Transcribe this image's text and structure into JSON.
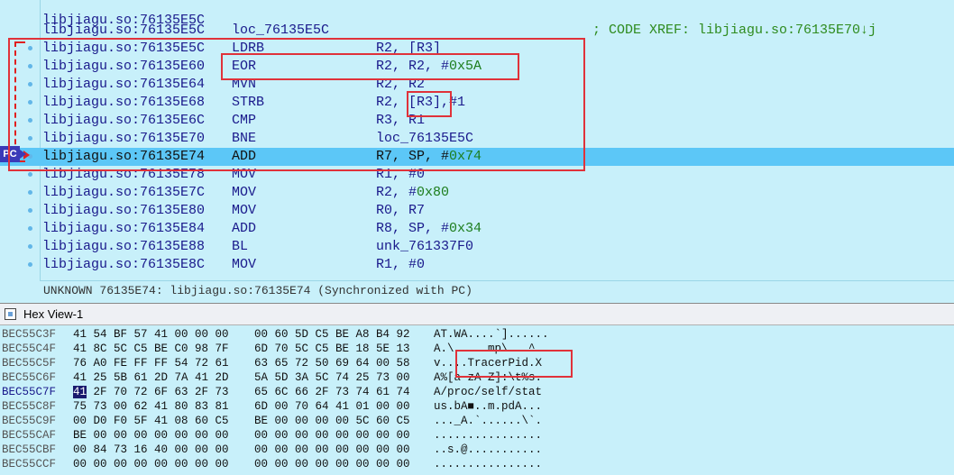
{
  "disasm": {
    "top_partial": "libjiagu.so:76135E5C",
    "rows": [
      {
        "addr": "libjiagu.so:76135E5C",
        "mnemonic": "loc_76135E5C",
        "operands": "",
        "comment": "; CODE XREF: libjiagu.so:76135E70↓j",
        "dot": false,
        "pc": false
      },
      {
        "addr": "libjiagu.so:76135E5C",
        "mnemonic": "LDRB",
        "operands": "R2, [R3]",
        "comment": "",
        "dot": true,
        "pc": false
      },
      {
        "addr": "libjiagu.so:76135E60",
        "mnemonic": "EOR",
        "operands": "R2, R2, #0x5A",
        "comment": "",
        "dot": true,
        "pc": false
      },
      {
        "addr": "libjiagu.so:76135E64",
        "mnemonic": "MVN",
        "operands": "R2, R2",
        "comment": "",
        "dot": true,
        "pc": false
      },
      {
        "addr": "libjiagu.so:76135E68",
        "mnemonic": "STRB",
        "operands": "R2, [R3],#1",
        "comment": "",
        "dot": true,
        "pc": false
      },
      {
        "addr": "libjiagu.so:76135E6C",
        "mnemonic": "CMP",
        "operands": "R3, R1",
        "comment": "",
        "dot": true,
        "pc": false
      },
      {
        "addr": "libjiagu.so:76135E70",
        "mnemonic": "BNE",
        "operands": "loc_76135E5C",
        "comment": "",
        "dot": true,
        "pc": false
      },
      {
        "addr": "libjiagu.so:76135E74",
        "mnemonic": "ADD",
        "operands": "R7, SP, #0x74",
        "comment": "",
        "dot": true,
        "pc": true
      },
      {
        "addr": "libjiagu.so:76135E78",
        "mnemonic": "MOV",
        "operands": "R1, #0",
        "comment": "",
        "dot": true,
        "pc": false
      },
      {
        "addr": "libjiagu.so:76135E7C",
        "mnemonic": "MOV",
        "operands": "R2, #0x80",
        "comment": "",
        "dot": true,
        "pc": false
      },
      {
        "addr": "libjiagu.so:76135E80",
        "mnemonic": "MOV",
        "operands": "R0, R7",
        "comment": "",
        "dot": true,
        "pc": false
      },
      {
        "addr": "libjiagu.so:76135E84",
        "mnemonic": "ADD",
        "operands": "R8, SP, #0x34",
        "comment": "",
        "dot": true,
        "pc": false
      },
      {
        "addr": "libjiagu.so:76135E88",
        "mnemonic": "BL",
        "operands": "unk_761337F0",
        "comment": "",
        "dot": true,
        "pc": false
      },
      {
        "addr": "libjiagu.so:76135E8C",
        "mnemonic": "MOV",
        "operands": "R1, #0",
        "comment": "",
        "dot": true,
        "pc": false
      }
    ],
    "pc_label": "PC",
    "status_line": "UNKNOWN 76135E74: libjiagu.so:76135E74 (Synchronized with PC)"
  },
  "hex_view": {
    "title": "Hex View-1",
    "rows": [
      {
        "addr": "BEC55C3F",
        "bytes1": "41 54 BF 57 41 00 00 00",
        "bytes2": "00 60 5D C5 BE A8 B4 92",
        "ascii": "AT.WA....`]......"
      },
      {
        "addr": "BEC55C4F",
        "bytes1": "41 8C 5C C5 BE C0 98 7F",
        "bytes2": "6D 70 5C C5 BE 18 5E 13",
        "ascii": "A.\\.....mp\\...^."
      },
      {
        "addr": "BEC55C5F",
        "bytes1": "76 A0 FE FF FF 54 72 61",
        "bytes2": "63 65 72 50 69 64 00 58",
        "ascii": "v....TracerPid.X"
      },
      {
        "addr": "BEC55C6F",
        "bytes1": "41 25 5B 61 2D 7A 41 2D",
        "bytes2": "5A 5D 3A 5C 74 25 73 00",
        "ascii": "A%[a-zA-Z]:\\t%s."
      },
      {
        "addr": "BEC55C7F",
        "bytes1": "41 2F 70 72 6F 63 2F 73",
        "bytes2": "65 6C 66 2F 73 74 61 74",
        "ascii": "A/proc/self/stat",
        "current": true
      },
      {
        "addr": "BEC55C8F",
        "bytes1": "75 73 00 62 41 80 83 81",
        "bytes2": "6D 00 70 64 41 01 00 00",
        "ascii": "us.bA■..m.pdA..."
      },
      {
        "addr": "BEC55C9F",
        "bytes1": "00 D0 F0 5F 41 08 60 C5",
        "bytes2": "BE 00 00 00 00 5C 60 C5",
        "ascii": "..._A.`......\\`."
      },
      {
        "addr": "BEC55CAF",
        "bytes1": "BE 00 00 00 00 00 00 00",
        "bytes2": "00 00 00 00 00 00 00 00",
        "ascii": "................"
      },
      {
        "addr": "BEC55CBF",
        "bytes1": "00 84 73 16 40 00 00 00",
        "bytes2": "00 00 00 00 00 00 00 00",
        "ascii": "..s.@..........."
      },
      {
        "addr": "BEC55CCF",
        "bytes1": "00 00 00 00 00 00 00 00",
        "bytes2": "00 00 00 00 00 00 00 00",
        "ascii": "................"
      }
    ]
  },
  "colors": {
    "background": "#c8f0fa",
    "pc_highlight": "#5cc7f7",
    "annotation_red": "#e0323a",
    "address_blue": "#1a1a8c",
    "comment_green": "#2e8b1e"
  }
}
